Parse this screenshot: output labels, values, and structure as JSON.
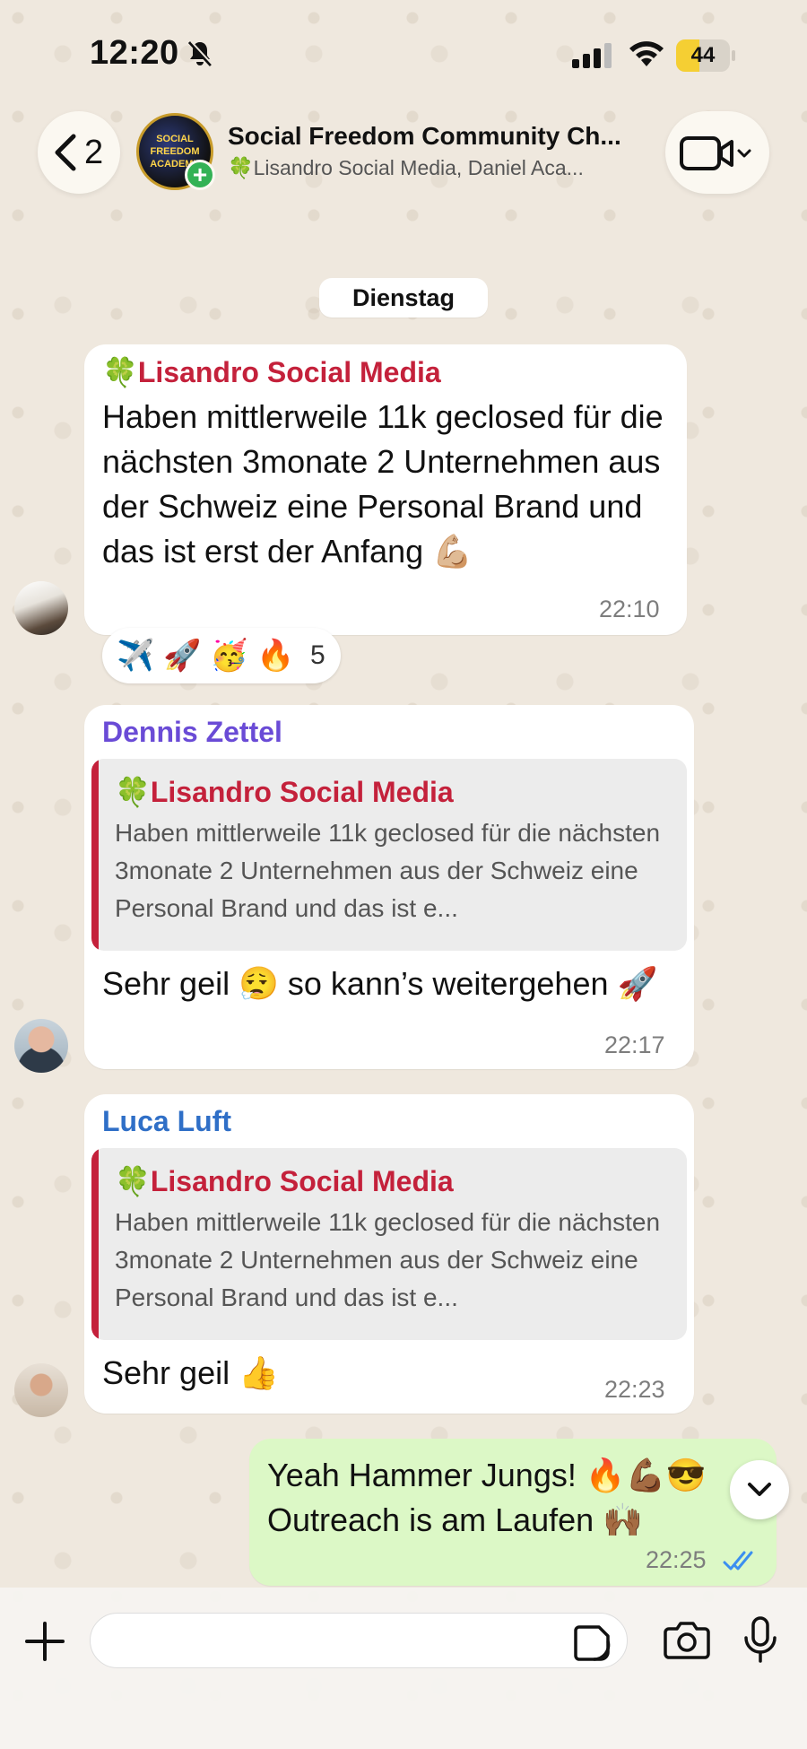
{
  "status": {
    "time": "12:20",
    "battery": "44",
    "battery_level": 0.44
  },
  "header": {
    "back_count": "2",
    "avatar_lines": [
      "SOCIAL",
      "FREEDOM",
      "ACADEMY"
    ],
    "title": "Social Freedom Community Ch...",
    "subtitle": "🍀Lisandro Social Media, Daniel Aca..."
  },
  "chat": {
    "date": "Dienstag",
    "messages": [
      {
        "sender": "🍀Lisandro Social Media",
        "sender_color": "#c4213b",
        "text": "Haben mittlerweile 11k geclosed für die nächsten 3monate 2 Unternehmen aus der Schweiz eine Personal Brand und das ist erst der Anfang 💪🏼",
        "time": "22:10",
        "reactions": [
          "✈️",
          "🚀",
          "🥳",
          "🔥"
        ],
        "reaction_count": "5"
      },
      {
        "sender": "Dennis Zettel",
        "sender_color": "#6a4bd6",
        "quote_sender": "🍀Lisandro Social Media",
        "quote_text": "Haben mittlerweile 11k geclosed für die nächsten 3monate 2 Unternehmen aus der Schweiz eine Personal Brand und das ist e...",
        "text": "Sehr geil 😮‍💨 so kann’s weitergehen 🚀",
        "time": "22:17"
      },
      {
        "sender": "Luca Luft",
        "sender_color": "#2f6fc7",
        "quote_sender": "🍀Lisandro Social Media",
        "quote_text": "Haben mittlerweile 11k geclosed für die nächsten 3monate 2 Unternehmen aus der Schweiz eine Personal Brand und das ist e...",
        "text": "Sehr geil 👍",
        "time": "22:23"
      }
    ],
    "outgoing": {
      "text": "Yeah Hammer Jungs! 🔥💪🏾😎 Outreach is am Laufen 🙌🏾",
      "time": "22:25"
    }
  },
  "input": {
    "placeholder": ""
  },
  "colors": {
    "outgoing_bubble": "#dcf8c6",
    "read_ticks": "#3b8ff0",
    "quote_bar": "#c4213b"
  },
  "icons": [
    "bell-slash-icon",
    "signal-icon",
    "wifi-icon",
    "battery-icon",
    "chevron-left-icon",
    "video-camera-icon",
    "chevron-down-icon",
    "plus-icon",
    "sticker-icon",
    "camera-icon",
    "microphone-icon",
    "double-check-icon"
  ]
}
